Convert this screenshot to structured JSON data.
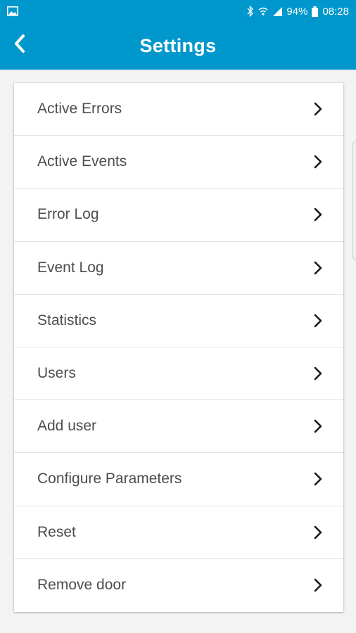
{
  "status_bar": {
    "battery": "94%",
    "time": "08:28"
  },
  "app_bar": {
    "title": "Settings"
  },
  "menu": {
    "items": [
      {
        "label": "Active Errors"
      },
      {
        "label": "Active Events"
      },
      {
        "label": "Error Log"
      },
      {
        "label": "Event Log"
      },
      {
        "label": "Statistics"
      },
      {
        "label": "Users"
      },
      {
        "label": "Add user"
      },
      {
        "label": "Configure Parameters"
      },
      {
        "label": "Reset"
      },
      {
        "label": "Remove door"
      }
    ]
  },
  "colors": {
    "primary": "#0098cc",
    "background": "#f3f3f3",
    "text": "#4d4d4d"
  }
}
